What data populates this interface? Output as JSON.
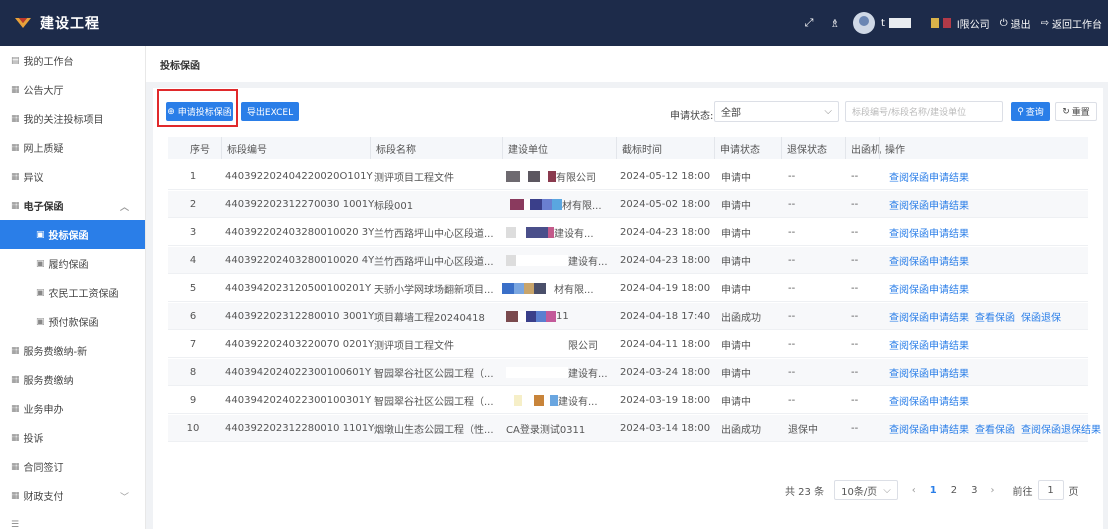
{
  "header": {
    "app_title": "建设工程",
    "user_initial": "t",
    "company_suffix": "l限公司",
    "logout_label": "退出",
    "return_label": "返回工作台"
  },
  "sidebar": {
    "items": [
      {
        "label": "我的工作台"
      },
      {
        "label": "公告大厅"
      },
      {
        "label": "我的关注投标项目"
      },
      {
        "label": "网上质疑"
      },
      {
        "label": "异议"
      },
      {
        "label": "电子保函"
      },
      {
        "label": "投标保函"
      },
      {
        "label": "履约保函"
      },
      {
        "label": "农民工工资保函"
      },
      {
        "label": "预付款保函"
      },
      {
        "label": "服务费缴纳-新"
      },
      {
        "label": "服务费缴纳"
      },
      {
        "label": "业务申办"
      },
      {
        "label": "投诉"
      },
      {
        "label": "合同签订"
      },
      {
        "label": "财政支付"
      }
    ]
  },
  "breadcrumb": {
    "title": "投标保函"
  },
  "toolbar": {
    "apply_label": "申请投标保函",
    "export_label": "导出EXCEL",
    "status_label": "申请状态:",
    "status_value": "全部",
    "search_placeholder": "标段编号/标段名称/建设单位",
    "query_label": "查询",
    "reset_label": "重置"
  },
  "table": {
    "headers": [
      "序号",
      "标段编号",
      "标段名称",
      "建设单位",
      "截标时间",
      "申请状态",
      "退保状态",
      "出函机",
      "操作"
    ],
    "rows": [
      {
        "no": "1",
        "code": "440392202404220020O101Y",
        "name": "测评项目工程文件",
        "unit": "有限公司",
        "time": "2024-05-12 18:00",
        "status": "申请中",
        "refund": "--",
        "issuer": "--",
        "ops": [
          "查阅保函申请结果"
        ]
      },
      {
        "no": "2",
        "code": "440392202312270030 1001Y",
        "name": "标段001",
        "unit": "材有限...",
        "time": "2024-05-02 18:00",
        "status": "申请中",
        "refund": "--",
        "issuer": "--",
        "ops": [
          "查阅保函申请结果"
        ]
      },
      {
        "no": "3",
        "code": "440392202403280010020 3Y",
        "name": "兰竹西路坪山中心区段道...",
        "unit": "建设有...",
        "time": "2024-04-23 18:00",
        "status": "申请中",
        "refund": "--",
        "issuer": "--",
        "ops": [
          "查阅保函申请结果"
        ]
      },
      {
        "no": "4",
        "code": "440392202403280010020 4Y",
        "name": "兰竹西路坪山中心区段道...",
        "unit": "建设有...",
        "time": "2024-04-23 18:00",
        "status": "申请中",
        "refund": "--",
        "issuer": "--",
        "ops": [
          "查阅保函申请结果"
        ]
      },
      {
        "no": "5",
        "code": "4403942023120500100201Y",
        "name": "天骄小学网球场翻新项目...",
        "unit": "材有限...",
        "time": "2024-04-19 18:00",
        "status": "申请中",
        "refund": "--",
        "issuer": "--",
        "ops": [
          "查阅保函申请结果"
        ]
      },
      {
        "no": "6",
        "code": "440392202312280010 3001Y",
        "name": "项目幕墙工程20240418",
        "unit": "11",
        "time": "2024-04-18 17:40",
        "status": "出函成功",
        "refund": "--",
        "issuer": "--",
        "ops": [
          "查阅保函申请结果",
          "查看保函",
          "保函退保"
        ]
      },
      {
        "no": "7",
        "code": "440392202403220070 0201Y",
        "name": "测评项目工程文件",
        "unit": "限公司",
        "time": "2024-04-11 18:00",
        "status": "申请中",
        "refund": "--",
        "issuer": "--",
        "ops": [
          "查阅保函申请结果"
        ]
      },
      {
        "no": "8",
        "code": "4403942024022300100601Y",
        "name": "智园翠谷社区公园工程（...",
        "unit": "建设有...",
        "time": "2024-03-24 18:00",
        "status": "申请中",
        "refund": "--",
        "issuer": "--",
        "ops": [
          "查阅保函申请结果"
        ]
      },
      {
        "no": "9",
        "code": "4403942024022300100301Y",
        "name": "智园翠谷社区公园工程（...",
        "unit": "建设有...",
        "time": "2024-03-19 18:00",
        "status": "申请中",
        "refund": "--",
        "issuer": "--",
        "ops": [
          "查阅保函申请结果"
        ]
      },
      {
        "no": "10",
        "code": "440392202312280010 1101Y",
        "name": "烟墩山生态公园工程（性...",
        "unit": "CA登录测试0311",
        "time": "2024-03-14 18:00",
        "status": "出函成功",
        "refund": "退保中",
        "issuer": "--",
        "ops": [
          "查阅保函申请结果",
          "查看保函",
          "查阅保函退保结果"
        ]
      }
    ]
  },
  "pagination": {
    "total": "共 23 条",
    "page_size": "10条/页",
    "pages": [
      "1",
      "2",
      "3"
    ],
    "current": "1",
    "goto_label": "前往",
    "goto_value": "1",
    "page_suffix": "页"
  },
  "colors": {
    "header_bg": "#1d2b4a",
    "primary": "#2a7ee8",
    "highlight_frame": "#e0292b"
  }
}
